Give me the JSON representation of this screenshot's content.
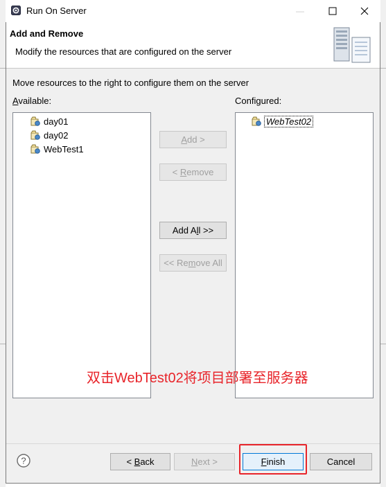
{
  "window": {
    "title": "Run On Server",
    "minimize_glyph": "—",
    "maximize_glyph": "☐",
    "close_glyph": "✕"
  },
  "header": {
    "title": "Add and Remove",
    "description": "Modify the resources that are configured on the server"
  },
  "instruction": "Move resources to the right to configure them on the server",
  "available": {
    "label_mnemonic": "A",
    "label_rest": "vailable:",
    "items": [
      "day01",
      "day02",
      "WebTest1"
    ]
  },
  "configured": {
    "label_pre": "Confi",
    "label_mnemonic": "g",
    "label_post": "ured:",
    "items": [
      "WebTest02"
    ]
  },
  "middle_buttons": {
    "add": {
      "pre": "",
      "mn": "A",
      "post": "dd >"
    },
    "remove": {
      "pre": "< ",
      "mn": "R",
      "post": "emove"
    },
    "add_all": {
      "pre": "Add A",
      "mn": "l",
      "post": "l >>"
    },
    "remove_all": {
      "pre": "<< Re",
      "mn": "m",
      "post": "ove All"
    }
  },
  "footer": {
    "back": {
      "pre": "< ",
      "mn": "B",
      "post": "ack"
    },
    "next": {
      "pre": "",
      "mn": "N",
      "post": "ext >"
    },
    "finish": {
      "pre": "",
      "mn": "F",
      "post": "inish"
    },
    "cancel": "Cancel"
  },
  "annotation": "双击WebTest02将项目部署至服务器",
  "colors": {
    "annotation": "#e8242a",
    "default_button_border": "#0078d7"
  },
  "icons": {
    "title": "eclipse-gear-icon",
    "project": "web-project-icon",
    "help": "help-icon",
    "header_art": "server-illustration-icon"
  }
}
